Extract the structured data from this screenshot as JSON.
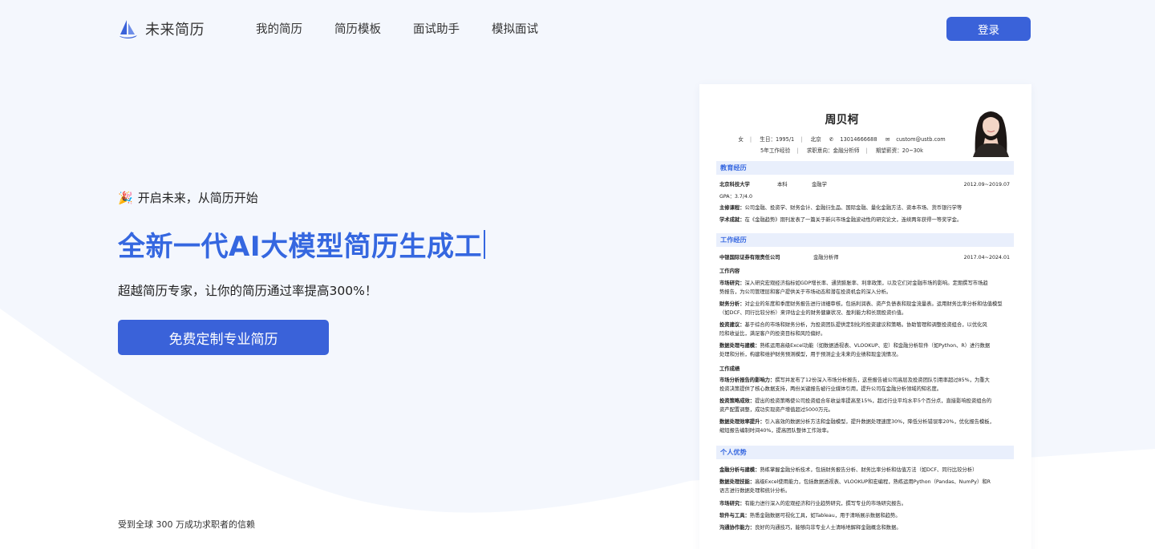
{
  "brand": {
    "name": "未来简历"
  },
  "nav": {
    "items": [
      "我的简历",
      "简历模板",
      "面试助手",
      "模拟面试"
    ],
    "login": "登录"
  },
  "hero": {
    "tagline": "开启未来，从简历开始",
    "headline": "全新一代AI大模型简历生成工",
    "subline": "超越简历专家，让你的简历通过率提高300%！",
    "cta": "免费定制专业简历",
    "trust": "受到全球 300 万成功求职者的信赖"
  },
  "colors": {
    "accent": "#3a62d9",
    "headline": "#3567e0",
    "section_bg": "#e9effc"
  },
  "icons": {
    "brand": "sailboat-icon",
    "tagline": "party-popper-icon"
  },
  "resume": {
    "name": "周贝柯",
    "info1": {
      "gender": "女",
      "birth": "生日：1995/1",
      "city": "北京",
      "phone": "13014666688",
      "email": "custom@ustb.com"
    },
    "info2": {
      "exp": "5年工作经验",
      "intent": "求职意向：金融分析师",
      "salary": "期望薪资：20~30k"
    },
    "education": {
      "title": "教育经历",
      "school": "北京科技大学",
      "degree": "本科",
      "major": "金融学",
      "date": "2012.09~2019.07",
      "gpa": "GPA：3.7/4.0",
      "courses_label": "主修课程：",
      "courses": "公司金融、投资学、财务会计、金融衍生品、国际金融、量化金融方法、资本市场、货币银行学等",
      "achieve_label": "学术成就：",
      "achieve": "在《金融趋势》期刊发表了一篇关于新兴市场金融波动性的研究论文，连续两年获得一等奖学金。"
    },
    "work": {
      "title": "工作经历",
      "company": "中银国际证券有限责任公司",
      "role": "金融分析师",
      "date": "2017.04~2024.01",
      "content_title": "工作内容",
      "items": [
        {
          "label": "市场研究：",
          "l1": "深入研究宏观经济指标如GDP增长率、通货膨胀率、利率政策，以及它们对金融市场的影响。定期撰写市场趋",
          "l2": "势报告，为公司管理层和客户提供关于市场动态和潜在投资机会的深入分析。"
        },
        {
          "label": "财务分析：",
          "l1": "对企业的年度和季度财务报告进行详细审核，包括利润表、资产负债表和现金流量表。运用财务比率分析和估值模型",
          "l2": "（如DCF、同行比较分析）来评估企业的财务健康状况、盈利能力和长期投资价值。"
        },
        {
          "label": "投资建议：",
          "l1": "基于综合的市场和财务分析，为投资团队提供定制化的投资建议和策略。协助管理和调整投资组合，以优化风",
          "l2": "险和收益比，满足客户的投资目标和风险偏好。"
        },
        {
          "label": "数据处理与建模：",
          "l1": "熟练运用高级Excel功能（如数据透视表、VLOOKUP、宏）和金融分析软件（如Python、R）进行数据",
          "l2": "处理和分析，构建和维护财务预测模型，用于预测企业未来的业绩和现金流情况。"
        }
      ],
      "result_title": "工作成绩",
      "results": [
        {
          "label": "市场分析报告的影响力：",
          "l1": "撰写并发布了12份深入市场分析报告，这些报告被公司高层及投资团队引用率超过85%，为重大",
          "l2": "投资决策提供了核心数据支持，两份关键报告被行业媒体引用，提升公司在金融分析领域的知名度。"
        },
        {
          "label": "投资策略成效：",
          "l1": "提出的投资策略使公司投资组合年收益率提高至15%，超过行业平均水平5个百分点，直接影响投资组合的",
          "l2": "资产配置调整，成功实现资产增值超过5000万元。"
        },
        {
          "label": "数据处理效率提升：",
          "l1": "引入高效的数据分析方法和金融模型，提升数据处理速度30%，降低分析错误率20%，优化报告模板，",
          "l2": "缩短报告编制时间40%，提高团队整体工作效率。"
        }
      ]
    },
    "advantages": {
      "title": "个人优势",
      "items": [
        {
          "label": "金融分析与建模：",
          "l1": "熟练掌握金融分析技术，包括财务报告分析、财务比率分析和估值方法（如DCF、同行比较分析）",
          "l2": ""
        },
        {
          "label": "数据处理技能：",
          "l1": "高级Excel使用能力，包括数据透视表、VLOOKUP和宏编程，熟练运用Python（Pandas、NumPy）和R",
          "l2": "语言进行数据处理和统计分析。"
        },
        {
          "label": "市场研究：",
          "l1": "有能力进行深入的宏观经济和行业趋势研究，撰写专业的市场研究报告。",
          "l2": ""
        },
        {
          "label": "软件与工具：",
          "l1": "熟悉金融数据可视化工具，如Tableau，用于清晰展示数据和趋势。",
          "l2": ""
        },
        {
          "label": "沟通协作能力：",
          "l1": "良好的沟通技巧，能够向非专业人士清晰地解释金融概念和数据。",
          "l2": ""
        }
      ]
    }
  }
}
